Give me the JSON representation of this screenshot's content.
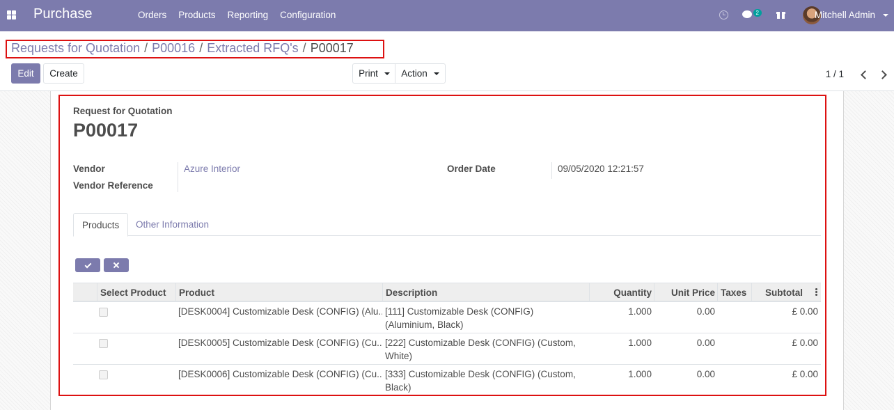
{
  "navbar": {
    "app_title": "Purchase",
    "menu": [
      "Orders",
      "Products",
      "Reporting",
      "Configuration"
    ],
    "chat_count": "2",
    "user_name": "Mitchell Admin",
    "accent_color": "#7c7bad"
  },
  "breadcrumb": {
    "items": [
      "Requests for Quotation",
      "P00016",
      "Extracted RFQ's"
    ],
    "separator": "/",
    "current": "P00017"
  },
  "toolbar": {
    "edit_label": "Edit",
    "create_label": "Create",
    "print_label": "Print",
    "action_label": "Action",
    "pager": "1 / 1"
  },
  "form": {
    "title_label": "Request for Quotation",
    "title_value": "P00017",
    "vendor_label": "Vendor",
    "vendor_value": "Azure Interior",
    "vendor_ref_label": "Vendor Reference",
    "vendor_ref_value": "",
    "order_date_label": "Order Date",
    "order_date_value": "09/05/2020 12:21:57"
  },
  "tabs": [
    "Products",
    "Other Information"
  ],
  "table": {
    "columns": [
      "Select Product",
      "Product",
      "Description",
      "Quantity",
      "Unit Price",
      "Taxes",
      "Subtotal"
    ],
    "rows": [
      {
        "selected": false,
        "product": "[DESK0004] Customizable Desk (CONFIG) (Alu...",
        "description": "[111] Customizable Desk (CONFIG) (Aluminium, Black)",
        "quantity": "1.000",
        "unit_price": "0.00",
        "taxes": "",
        "subtotal": "£ 0.00"
      },
      {
        "selected": false,
        "product": "[DESK0005] Customizable Desk (CONFIG) (Cu...",
        "description": "[222] Customizable Desk (CONFIG) (Custom, White)",
        "quantity": "1.000",
        "unit_price": "0.00",
        "taxes": "",
        "subtotal": "£ 0.00"
      },
      {
        "selected": false,
        "product": "[DESK0006] Customizable Desk (CONFIG) (Cu...",
        "description": "[333] Customizable Desk (CONFIG) (Custom, Black)",
        "quantity": "1.000",
        "unit_price": "0.00",
        "taxes": "",
        "subtotal": "£ 0.00"
      }
    ]
  },
  "icons": [
    "apps-icon",
    "clock-icon",
    "chat-icon",
    "gift-icon",
    "chevron-left-icon",
    "chevron-right-icon",
    "check-icon",
    "close-icon",
    "options-icon"
  ]
}
